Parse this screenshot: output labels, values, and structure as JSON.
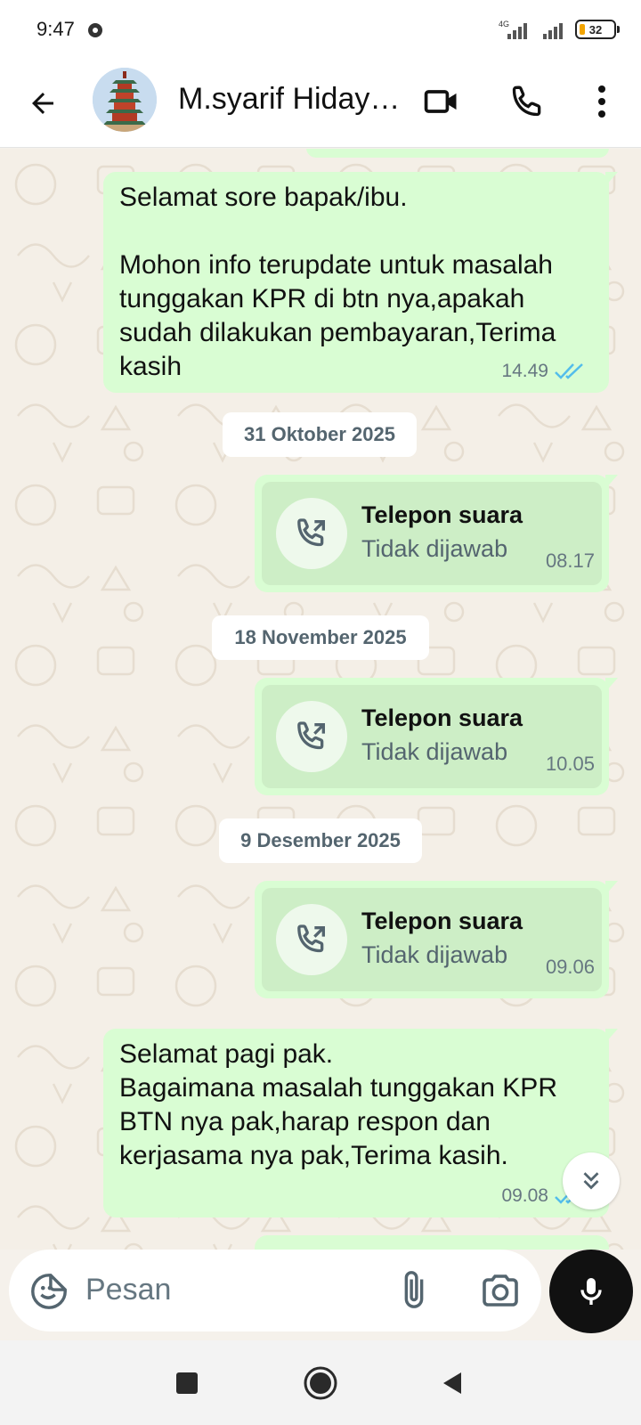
{
  "status_bar": {
    "time": "9:47",
    "network": "4G",
    "battery": "32"
  },
  "header": {
    "contact_name": "M.syarif Hiday…",
    "icons": [
      "back-arrow-icon",
      "avatar",
      "video-call-icon",
      "voice-call-icon",
      "more-vert-icon"
    ]
  },
  "messages": [
    {
      "type": "text",
      "text": "Selamat sore bapak/ibu.\n\nMohon info terupdate untuk masalah tunggakan KPR di btn nya,apakah sudah dilakukan pembayaran,Terima kasih",
      "time": "14.49",
      "read": true
    },
    {
      "type": "date",
      "text": "31 Oktober 2025"
    },
    {
      "type": "call",
      "title": "Telepon suara",
      "subtitle": "Tidak dijawab",
      "time": "08.17"
    },
    {
      "type": "date",
      "text": "18 November 2025"
    },
    {
      "type": "call",
      "title": "Telepon suara",
      "subtitle": "Tidak dijawab",
      "time": "10.05"
    },
    {
      "type": "date",
      "text": "9 Desember 2025"
    },
    {
      "type": "call",
      "title": "Telepon suara",
      "subtitle": "Tidak dijawab",
      "time": "09.06"
    },
    {
      "type": "text",
      "text": "Selamat pagi pak.\nBagaimana masalah tunggakan KPR BTN nya pak,harap respon dan kerjasama nya pak,Terima kasih.",
      "time": "09.08",
      "read": true
    }
  ],
  "input": {
    "placeholder": "Pesan"
  },
  "colors": {
    "outgoing_bubble": "#d9fdd3",
    "read_tick": "#53bdeb",
    "chat_bg": "#f4efe7"
  }
}
